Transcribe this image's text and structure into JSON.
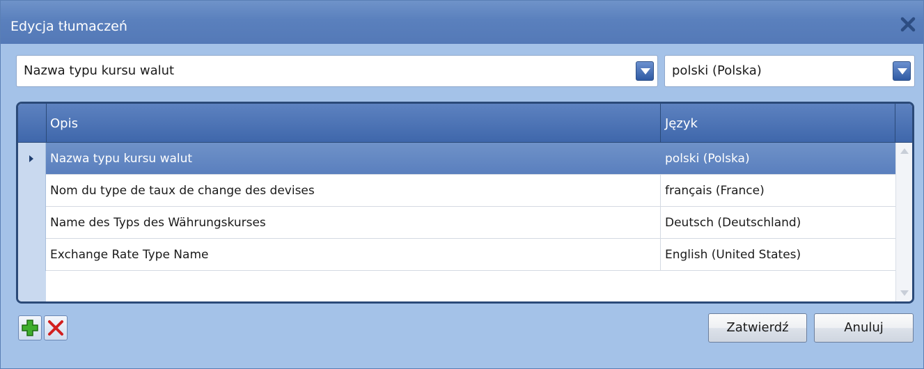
{
  "window": {
    "title": "Edycja tłumaczeń"
  },
  "combos": {
    "field": {
      "value": "Nazwa typu kursu walut"
    },
    "language": {
      "value": "polski (Polska)"
    }
  },
  "grid": {
    "columns": [
      "Opis",
      "Język"
    ],
    "rows": [
      {
        "opis": "Nazwa typu kursu walut",
        "jezyk": "polski (Polska)",
        "selected": true
      },
      {
        "opis": "Nom du type de taux de change des devises",
        "jezyk": "français (France)"
      },
      {
        "opis": "Name des Typs des Währungskurses",
        "jezyk": "Deutsch (Deutschland)"
      },
      {
        "opis": "Exchange Rate Type Name",
        "jezyk": "English (United States)"
      }
    ]
  },
  "buttons": {
    "confirm": "Zatwierdź",
    "cancel": "Anuluj"
  },
  "icons": {
    "add": "plus-icon",
    "delete": "x-icon",
    "close": "close-icon"
  },
  "colors": {
    "titlebar": "#5a80bd",
    "window_bg": "#a4c2e8",
    "selected_row": "#6f92c8",
    "grid_border": "#2b4a78"
  }
}
